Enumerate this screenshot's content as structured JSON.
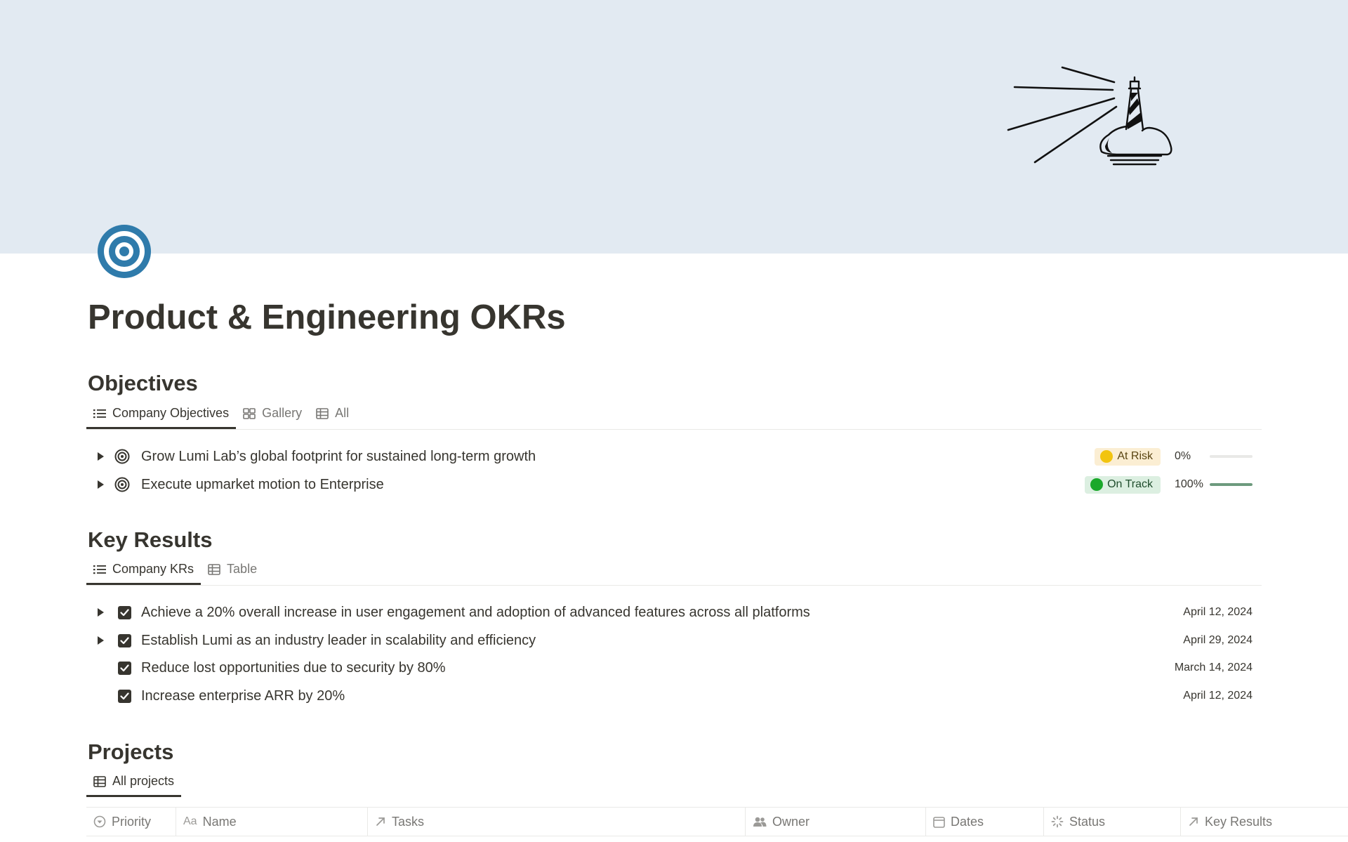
{
  "page": {
    "title": "Product & Engineering OKRs"
  },
  "objectives": {
    "heading": "Objectives",
    "tabs": [
      {
        "label": "Company Objectives",
        "icon": "list-icon",
        "active": true
      },
      {
        "label": "Gallery",
        "icon": "gallery-icon",
        "active": false
      },
      {
        "label": "All",
        "icon": "table-icon",
        "active": false
      }
    ],
    "items": [
      {
        "label": "Grow Lumi Lab’s global footprint for sustained long-term growth",
        "status": "At Risk",
        "status_color": "#e8b80a",
        "progress_label": "0%",
        "progress": 0
      },
      {
        "label": "Execute upmarket motion to Enterprise",
        "status": "On Track",
        "status_color": "#1e9e2c",
        "progress_label": "100%",
        "progress": 1
      }
    ]
  },
  "key_results": {
    "heading": "Key Results",
    "tabs": [
      {
        "label": "Company KRs",
        "icon": "list-icon",
        "active": true
      },
      {
        "label": "Table",
        "icon": "table-icon",
        "active": false
      }
    ],
    "items": [
      {
        "label": "Achieve a 20% overall increase in user engagement and adoption of advanced features across all platforms",
        "date": "April 12, 2024",
        "expandable": true,
        "checked": true
      },
      {
        "label": "Establish Lumi as an industry leader in scalability and efficiency",
        "date": "April 29, 2024",
        "expandable": true,
        "checked": true
      },
      {
        "label": "Reduce lost opportunities due to security by 80%",
        "date": "March 14, 2024",
        "expandable": false,
        "checked": true
      },
      {
        "label": "Increase enterprise ARR by 20%",
        "date": "April 12, 2024",
        "expandable": false,
        "checked": true
      }
    ]
  },
  "projects": {
    "heading": "Projects",
    "tabs": [
      {
        "label": "All projects",
        "icon": "table-icon",
        "active": true
      }
    ],
    "columns": [
      {
        "label": "Priority",
        "icon": "select-icon"
      },
      {
        "label": "Name",
        "icon": "text-property-icon"
      },
      {
        "label": "Tasks",
        "icon": "relation-arrow-icon"
      },
      {
        "label": "Owner",
        "icon": "people-icon"
      },
      {
        "label": "Dates",
        "icon": "calendar-icon"
      },
      {
        "label": "Status",
        "icon": "status-icon"
      },
      {
        "label": "Key Results",
        "icon": "relation-arrow-icon"
      }
    ],
    "name_icon_text": "Aa"
  },
  "colors": {
    "cover": "#e2eaf2",
    "page_icon": "#2f7bab",
    "text": "#37352f",
    "muted": "#787774",
    "progress": "#6d9a7d"
  }
}
